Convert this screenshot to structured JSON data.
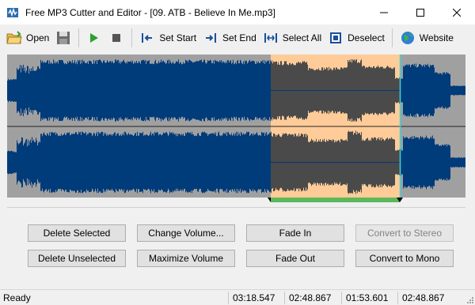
{
  "window": {
    "title": "Free MP3 Cutter and Editor - [09. ATB - Believe In Me.mp3]",
    "controls": {
      "minimize": "─",
      "maximize": "☐",
      "close": "✕"
    }
  },
  "toolbar": {
    "open_label": "Open",
    "set_start_label": "Set Start",
    "set_end_label": "Set End",
    "select_all_label": "Select All",
    "deselect_label": "Deselect",
    "website_label": "Website"
  },
  "waveform": {
    "channels": 2,
    "selection_start": 0.575,
    "selection_end": 0.856,
    "colors": {
      "wave": "#003b7a",
      "selection_bg": "#ffcc99",
      "selection_wave": "#4a4a4a",
      "background": "#a0a0a0",
      "selection_dark": "#4d4d4d",
      "progress": "#5cb85c"
    }
  },
  "actions": {
    "delete_selected": "Delete Selected",
    "change_volume": "Change Volume...",
    "fade_in": "Fade In",
    "convert_stereo": "Convert to Stereo",
    "delete_unselected": "Delete Unselected",
    "maximize_volume": "Maximize Volume",
    "fade_out": "Fade Out",
    "convert_mono": "Convert to Mono"
  },
  "status": {
    "state": "Ready",
    "total_length": "03:18.547",
    "selection_start": "02:48.867",
    "selection_length": "01:53.601",
    "selection_end": "02:48.867"
  }
}
